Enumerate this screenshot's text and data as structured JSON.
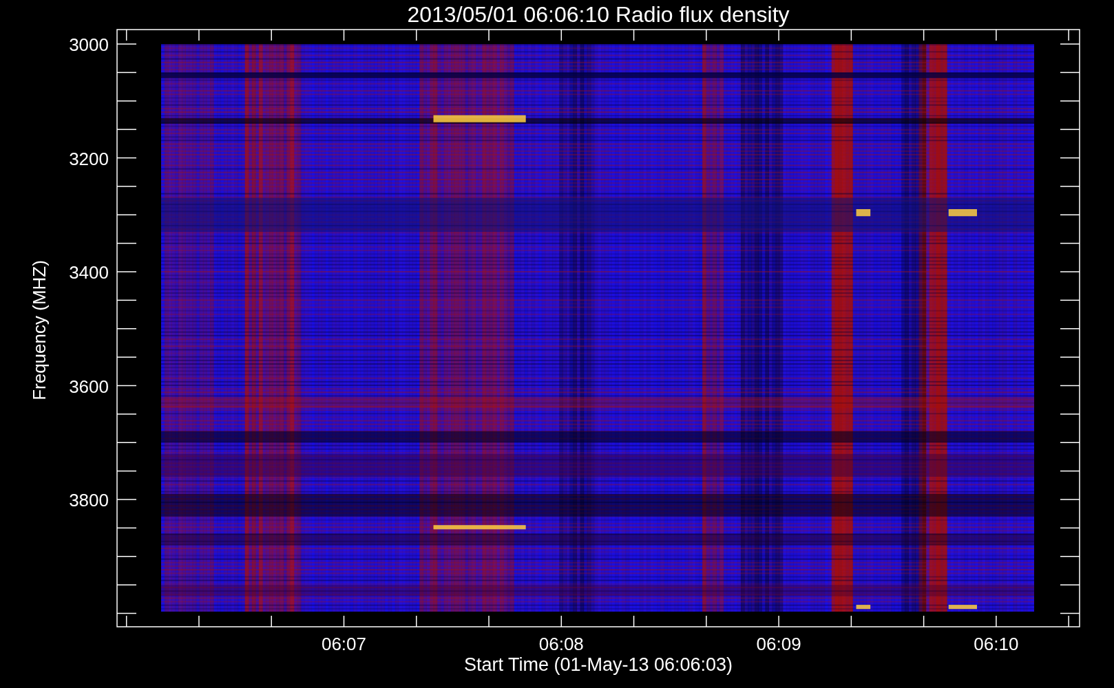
{
  "title": "2013/05/01 06:06:10 Radio flux density",
  "y_axis": {
    "label": "Frequency (MHZ)",
    "tick_labels": [
      "3000",
      "3200",
      "3400",
      "3600",
      "3800"
    ]
  },
  "x_axis": {
    "label": "Start Time (01-May-13 06:06:03)",
    "tick_labels": [
      "06:07",
      "06:08",
      "06:09",
      "06:10"
    ]
  }
}
